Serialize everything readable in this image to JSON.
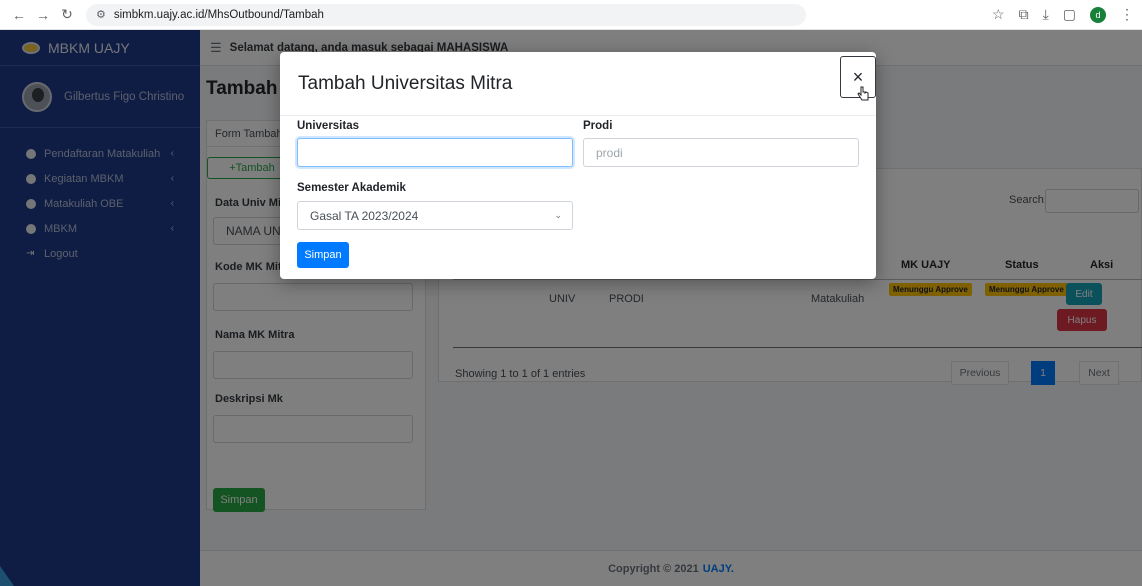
{
  "browser": {
    "url": "simbkm.uajy.ac.id/MhsOutbound/Tambah",
    "profile_initial": "d"
  },
  "sidebar": {
    "brand": "MBKM UAJY",
    "user_name": "Gilbertus Figo Christino",
    "items": [
      {
        "label": "Pendaftaran Matakuliah",
        "icon": "circle-icon"
      },
      {
        "label": "Kegiatan MBKM",
        "icon": "circle-icon"
      },
      {
        "label": "Matakuliah OBE",
        "icon": "circle-icon"
      },
      {
        "label": "MBKM",
        "icon": "circle-icon"
      },
      {
        "label": "Logout",
        "icon": "logout-icon"
      }
    ]
  },
  "topbar": {
    "welcome": "Selamat datang, anda masuk sebagai MAHASISWA"
  },
  "page": {
    "title": "Tambah P",
    "form_header": "Form Tambah",
    "tambah_label": "Tambah",
    "data_univ_label": "Data Univ Mit",
    "data_univ_value": "NAMA UN",
    "kode_label": "Kode MK Mitr",
    "nama_label": "Nama MK Mitra",
    "deskripsi_label": "Deskripsi Mk",
    "simpan_label": "Simpan"
  },
  "table": {
    "search_label": "Search:",
    "columns": [
      "MK UAJY",
      "Status",
      "Aksi"
    ],
    "row": {
      "univ": "UNIV",
      "prodi": "PRODI",
      "matakuliah": "Matakuliah",
      "badge_1": "Menunggu Approve",
      "badge_2": "Menunggu Approve",
      "edit": "Edit",
      "hapus": "Hapus"
    },
    "showing": "Showing 1 to 1 of 1 entries",
    "pagination": {
      "previous": "Previous",
      "current": "1",
      "next": "Next"
    }
  },
  "footer": {
    "text": "Copyright © 2021",
    "brand": "UAJY."
  },
  "modal": {
    "title": "Tambah Universitas Mitra",
    "close": "×",
    "universitas_label": "Universitas",
    "universitas_value": "",
    "prodi_label": "Prodi",
    "prodi_placeholder": "prodi",
    "semester_label": "Semester Akademik",
    "semester_selected": "Gasal TA 2023/2024",
    "simpan_label": "Simpan"
  },
  "colors": {
    "sidebar": "#1e3a8a",
    "primary": "#007bff",
    "success": "#28a745",
    "info": "#17a2b8",
    "danger": "#dc3545",
    "warning": "#ffc107"
  }
}
